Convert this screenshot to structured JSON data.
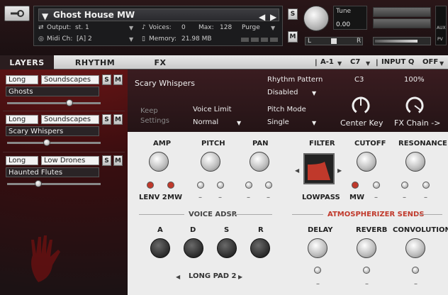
{
  "header": {
    "instrument_name": "Ghost House MW",
    "output_label": "Output:",
    "output_value": "st. 1",
    "voices_label": "Voices:",
    "voices_value": "0",
    "max_label": "Max:",
    "max_value": "128",
    "purge_label": "Purge",
    "midi_label": "Midi Ch:",
    "midi_value": "[A]  2",
    "memory_label": "Memory:",
    "memory_value": "21.98 MB",
    "s_label": "S",
    "m_label": "M",
    "tune_label": "Tune",
    "tune_value": "0.00",
    "l_label": "L",
    "r_label": "R",
    "aux_label": "AUX",
    "pv_label": "PV"
  },
  "tabs": [
    {
      "label": "LAYERS"
    },
    {
      "label": "RHYTHM"
    },
    {
      "label": "FX"
    }
  ],
  "tabbar": {
    "preset": "A-1",
    "key": "C7",
    "input_q_label": "INPUT Q",
    "input_q_value": "OFF"
  },
  "layers": [
    {
      "type": "Long",
      "category": "Soundscapes",
      "name": "Ghosts",
      "s": "S",
      "m": "M",
      "level": 0.68
    },
    {
      "type": "Long",
      "category": "Soundscapes",
      "name": "Scary Whispers",
      "s": "S",
      "m": "M",
      "level": 0.42
    },
    {
      "type": "Long",
      "category": "Low Drones",
      "name": "Haunted Flutes",
      "s": "S",
      "m": "M",
      "level": 0.32
    }
  ],
  "top": {
    "layer_title": "Scary Whispers",
    "keep_settings": "Keep\nSettings",
    "voice_limit_label": "Voice Limit",
    "voice_limit_value": "Normal",
    "rhythm_pattern_label": "Rhythm Pattern",
    "rhythm_pattern_value": "Disabled",
    "pitch_mode_label": "Pitch Mode",
    "pitch_mode_value": "Single",
    "center_key_value": "C3",
    "center_key_label": "Center Key",
    "fx_chain_value": "100%",
    "fx_chain_label": "FX Chain ->"
  },
  "mod": {
    "amp": "AMP",
    "pitch": "PITCH",
    "pan": "PAN",
    "filter": "FILTER",
    "cutoff": "CUTOFF",
    "resonance": "RESONANCE",
    "lenv": "LENV 2",
    "mw": "MW",
    "lowpass": "LOWPASS",
    "cutoff_mw": "MW",
    "dash": "–"
  },
  "adsr": {
    "title": "VOICE ADSR",
    "a": "A",
    "d": "D",
    "s": "S",
    "r": "R",
    "preset": "LONG PAD 2"
  },
  "sends": {
    "title": "ATMOSPHERIZER SENDS",
    "delay": "DELAY",
    "reverb": "REVERB",
    "convolution": "CONVOLUTION",
    "dash": "–"
  },
  "colors": {
    "accent": "#c0392b",
    "panel": "#ececec",
    "dark": "#1c1214"
  }
}
